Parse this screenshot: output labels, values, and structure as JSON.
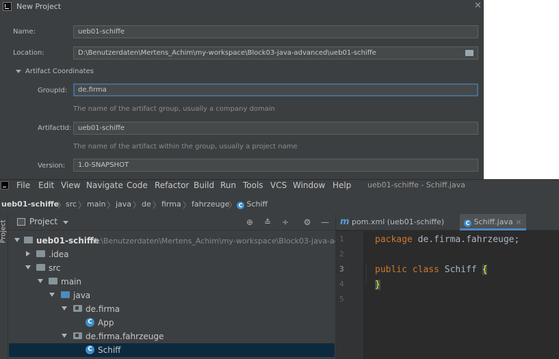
{
  "dialog": {
    "title": "New Project",
    "close_glyph": "✕",
    "name_label": "Name:",
    "name_value": "ueb01-schiffe",
    "location_label": "Location:",
    "location_value": "D:\\Benutzerdaten\\Mertens_Achim\\my-workspace\\Block03-java-advanced\\ueb01-schiffe",
    "artifact_section": "Artifact Coordinates",
    "groupid_label": "GroupId:",
    "groupid_value": "de.firma",
    "groupid_hint": "The name of the artifact group, usually a company domain",
    "artifactid_label": "ArtifactId:",
    "artifactid_value": "ueb01-schiffe",
    "artifactid_hint": "The name of the artifact within the group, usually a project name",
    "version_label": "Version:",
    "version_value": "1.0-SNAPSHOT"
  },
  "menubar": {
    "items": [
      "File",
      "Edit",
      "View",
      "Navigate",
      "Code",
      "Refactor",
      "Build",
      "Run",
      "Tools",
      "VCS",
      "Window",
      "Help"
    ],
    "window_title": "ueb01-schiffe - Schiff.java"
  },
  "breadcrumb": [
    "ueb01-schiffe",
    "src",
    "main",
    "java",
    "de",
    "firma",
    "fahrzeuge",
    "Schiff"
  ],
  "sidebar": {
    "strip_label": "Project"
  },
  "project_panel": {
    "title": "Project",
    "tree": [
      {
        "label": "ueb01-schiffe",
        "path": "D:\\Benutzerdaten\\Mertens_Achim\\my-workspace\\Block03-java-ad"
      },
      {
        "label": ".idea"
      },
      {
        "label": "src"
      },
      {
        "label": "main"
      },
      {
        "label": "java"
      },
      {
        "label": "de.firma"
      },
      {
        "label": "App"
      },
      {
        "label": "de.firma.fahrzeuge"
      },
      {
        "label": "Schiff"
      }
    ]
  },
  "editor": {
    "tabs": [
      {
        "icon": "m",
        "label": "pom.xml (ueb01-schiffe)"
      },
      {
        "icon": "C",
        "label": "Schiff.java",
        "close": "×"
      }
    ],
    "line_numbers": [
      "1",
      "2",
      "3",
      "4",
      "5"
    ],
    "code": {
      "line1_kw": "package",
      "line1_rest": " de.firma.fahrzeuge;",
      "line3_kw1": "public",
      "line3_kw2": "class",
      "line3_name": " Schiff ",
      "line3_brace": "{",
      "line4_brace": "}"
    }
  },
  "colors": {
    "dialog_bg": "#3c3f41",
    "editor_bg": "#2b2b2b",
    "keyword": "#cc7832",
    "accent": "#4a88c7",
    "selection": "#0d293e"
  }
}
